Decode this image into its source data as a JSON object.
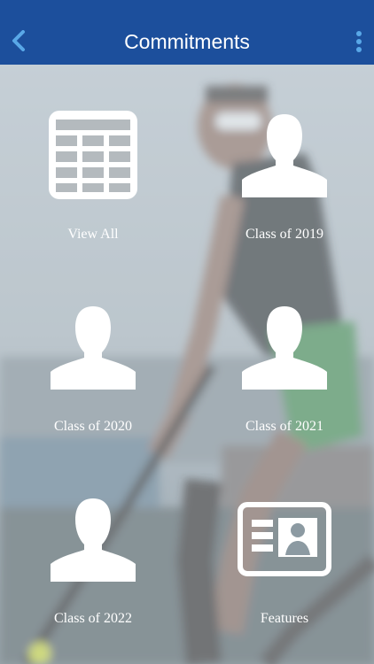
{
  "header": {
    "title": "Commitments",
    "back_icon": "chevron-left-icon",
    "menu_icon": "more-vertical-icon",
    "background_color": "#1c4f9c",
    "icon_color": "#59a8e8"
  },
  "tiles": [
    {
      "label": "View All",
      "icon": "table-grid-icon"
    },
    {
      "label": "Class of 2019",
      "icon": "person-icon"
    },
    {
      "label": "Class of 2020",
      "icon": "person-icon"
    },
    {
      "label": "Class of 2021",
      "icon": "person-icon"
    },
    {
      "label": "Class of 2022",
      "icon": "person-icon"
    },
    {
      "label": "Features",
      "icon": "id-card-icon"
    }
  ]
}
